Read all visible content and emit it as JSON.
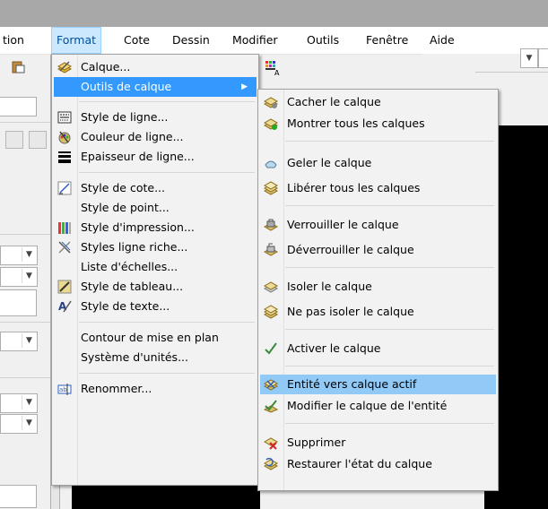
{
  "menubar": {
    "items": [
      "tion",
      "Format",
      "Cote",
      "Dessin",
      "Modifier",
      "Outils",
      "Fenêtre",
      "Aide"
    ]
  },
  "format_menu": {
    "items": [
      {
        "label": "Calque...",
        "icon": "layers-icon"
      },
      {
        "label": "Outils de calque",
        "icon": "",
        "submenu": true
      },
      {
        "label": "Style de ligne...",
        "icon": "linetype-icon"
      },
      {
        "label": "Couleur de ligne...",
        "icon": "line-color-icon"
      },
      {
        "label": "Epaisseur de ligne...",
        "icon": "lineweight-icon"
      },
      {
        "label": "Style de cote...",
        "icon": "dimstyle-icon"
      },
      {
        "label": "Style de point...",
        "icon": ""
      },
      {
        "label": "Style d'impression...",
        "icon": "plotstyle-icon"
      },
      {
        "label": "Styles ligne riche...",
        "icon": "mlinestyle-icon"
      },
      {
        "label": "Liste d'échelles...",
        "icon": ""
      },
      {
        "label": "Style de tableau...",
        "icon": "tablestyle-icon"
      },
      {
        "label": "Style de texte...",
        "icon": "textstyle-icon"
      },
      {
        "label": "Contour de mise en plan",
        "icon": ""
      },
      {
        "label": "Système d'unités...",
        "icon": ""
      },
      {
        "label": "Renommer...",
        "icon": "rename-icon"
      }
    ]
  },
  "layer_tools_menu": {
    "items": [
      {
        "label": "Cacher le calque",
        "icon": "hide-layer-icon"
      },
      {
        "label": "Montrer tous les calques",
        "icon": "show-layers-icon"
      },
      {
        "label": "Geler le calque",
        "icon": "freeze-layer-icon"
      },
      {
        "label": "Libérer tous les calques",
        "icon": "thaw-layers-icon"
      },
      {
        "label": "Verrouiller le calque",
        "icon": "lock-layer-icon"
      },
      {
        "label": "Déverrouiller le calque",
        "icon": "unlock-layer-icon"
      },
      {
        "label": "Isoler le calque",
        "icon": "isolate-layer-icon"
      },
      {
        "label": "Ne pas isoler le calque",
        "icon": "unisolate-layer-icon"
      },
      {
        "label": "Activer le calque",
        "icon": "checkmark-icon"
      },
      {
        "label": "Entité vers calque actif",
        "icon": "entity-to-layer-icon"
      },
      {
        "label": "Modifier le calque de l'entité",
        "icon": "change-entity-layer-icon"
      },
      {
        "label": "Supprimer",
        "icon": "delete-layer-icon"
      },
      {
        "label": "Restaurer l'état du calque",
        "icon": "restore-layer-icon"
      }
    ]
  },
  "colors": {
    "accent": "#3399ff",
    "hover": "#91c9f7",
    "canvas": "#000000"
  }
}
